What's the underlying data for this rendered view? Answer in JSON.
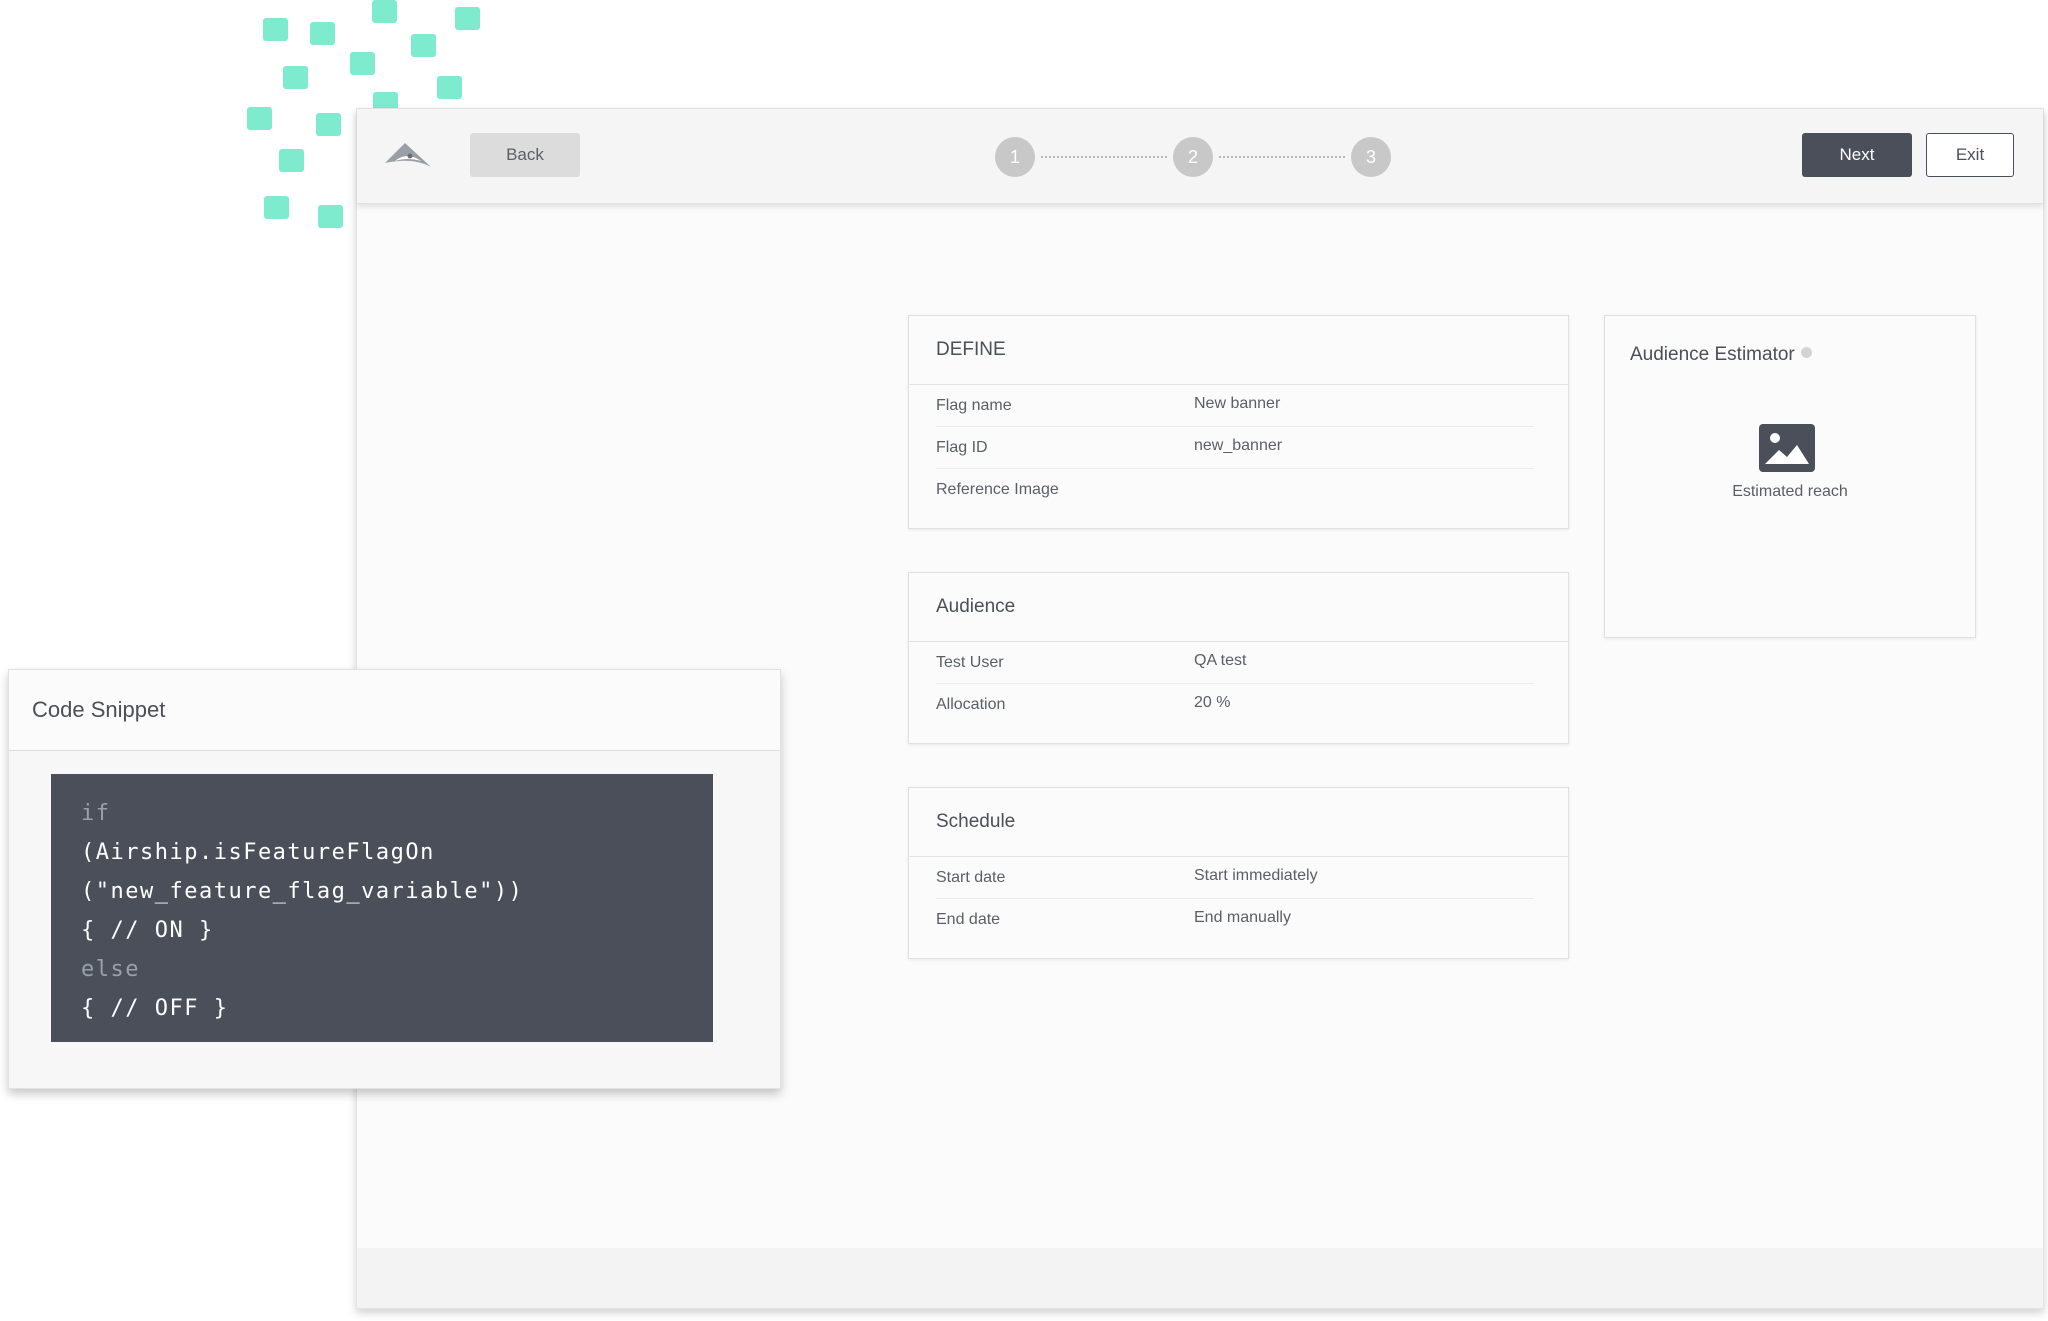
{
  "toolbar": {
    "back_label": "Back",
    "next_label": "Next",
    "exit_label": "Exit",
    "steps": [
      "1",
      "2",
      "3"
    ]
  },
  "define": {
    "title": "DEFINE",
    "rows": [
      {
        "label": "Flag name",
        "value": "New banner"
      },
      {
        "label": "Flag ID",
        "value": "new_banner"
      },
      {
        "label": "Reference Image",
        "value": ""
      }
    ]
  },
  "audience": {
    "title": "Audience",
    "rows": [
      {
        "label": "Test User",
        "value": "QA test"
      },
      {
        "label": "Allocation",
        "value": "20 %"
      }
    ]
  },
  "schedule": {
    "title": "Schedule",
    "rows": [
      {
        "label": "Start date",
        "value": "Start immediately"
      },
      {
        "label": "End date",
        "value": "End manually"
      }
    ]
  },
  "estimator": {
    "title": "Audience Estimator",
    "reach_label": "Estimated reach"
  },
  "snippet": {
    "title": "Code Snippet",
    "lines": [
      "if",
      "(Airship.isFeatureFlagOn",
      "(\"new_feature_flag_variable\"))",
      "{ // ON }",
      "else",
      "{ // OFF }"
    ]
  },
  "colors": {
    "accent_mint": "#7eebcf",
    "primary_button": "#4a4f59",
    "code_background": "#4a4f59",
    "step_circle": "#c8c8c8"
  },
  "icons": [
    "logo-icon",
    "image-placeholder-icon",
    "info-icon"
  ]
}
